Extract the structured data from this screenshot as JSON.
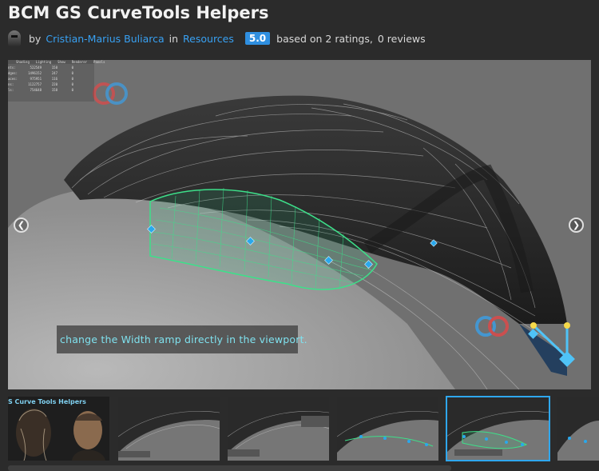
{
  "header": {
    "title": "BCM GS CurveTools Helpers",
    "by_label": "by",
    "author": "Cristian-Marius Buliarca",
    "in_label": "in",
    "category": "Resources",
    "rating": "5.0",
    "rating_text": "based on 2 ratings,",
    "reviews_text": "0 reviews"
  },
  "viewer": {
    "caption": "change the Width ramp directly in the viewport.",
    "stats_headers": [
      "Shading",
      "Lighting",
      "Show",
      "Renderer",
      "Panels"
    ],
    "stats_rows": [
      [
        "nts:",
        "522549",
        "158",
        "0"
      ],
      [
        "dges:",
        "1496152",
        "247",
        "0"
      ],
      [
        "aces:",
        "975951",
        "116",
        "0"
      ],
      [
        "ns:",
        "1122757",
        "220",
        "0"
      ],
      [
        "ls:",
        "754648",
        "158",
        "0"
      ]
    ],
    "prev_icon": "chevron-left-icon",
    "next_icon": "chevron-right-icon"
  },
  "thumbnails": {
    "first_label": "S Curve Tools Helpers",
    "active_index": 4,
    "count": 7
  },
  "colors": {
    "background": "#2b2b2b",
    "link": "#38a1f3",
    "rating_badge": "#2f8fe0",
    "caption_text": "#7fe1ee",
    "active_outline": "#2fa7ee",
    "curve_green": "#3de08a",
    "handle_blue": "#2aa8ec"
  }
}
